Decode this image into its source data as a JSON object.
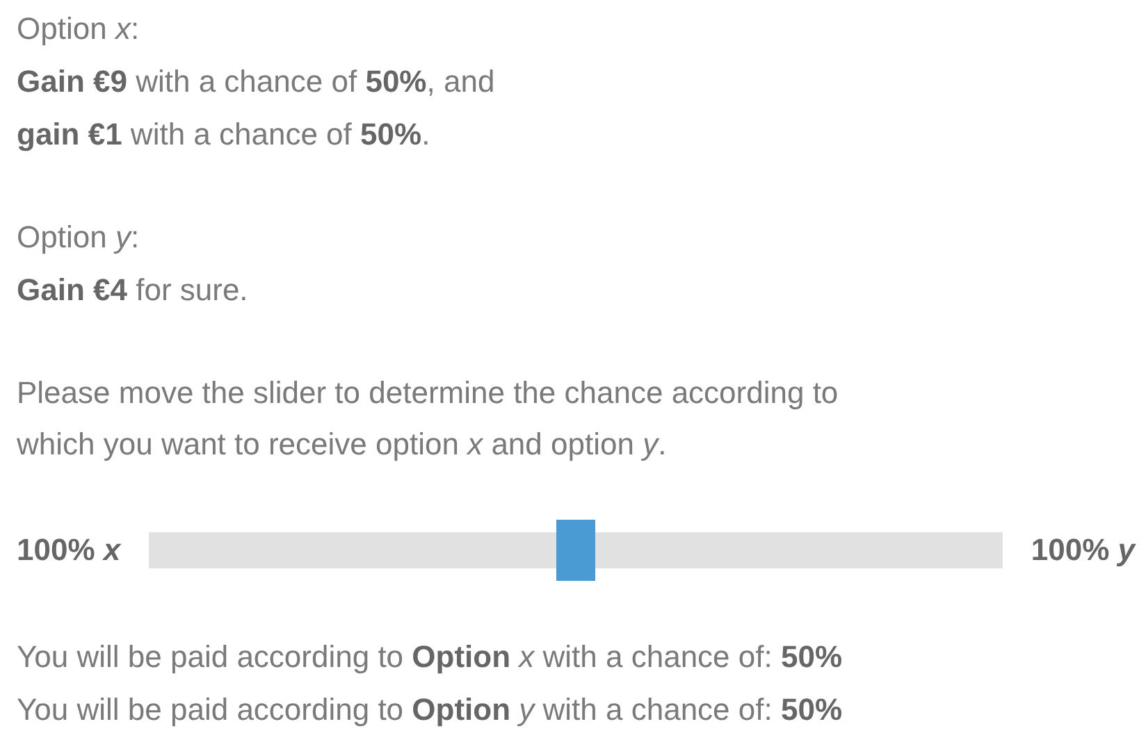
{
  "option_x": {
    "heading": "Option *x*:",
    "lines": [
      "**Gain €9** with a chance of **50%**, and",
      "**gain €1** with a chance of **50%**."
    ]
  },
  "option_y": {
    "heading": "Option *y*:",
    "lines": [
      "**Gain €4** for sure."
    ]
  },
  "instruction": "Please move the slider to determine the chance according to which you want to receive option *x* and option *y*.",
  "slider": {
    "left_label": "100% *x*",
    "right_label": "100% *y*",
    "level": 0.5
  },
  "results": [
    "You will be paid according to **Option** *x* with a chance of: **50%**",
    "You will be paid according to **Option** *y* with a chance of: **50%**"
  ]
}
